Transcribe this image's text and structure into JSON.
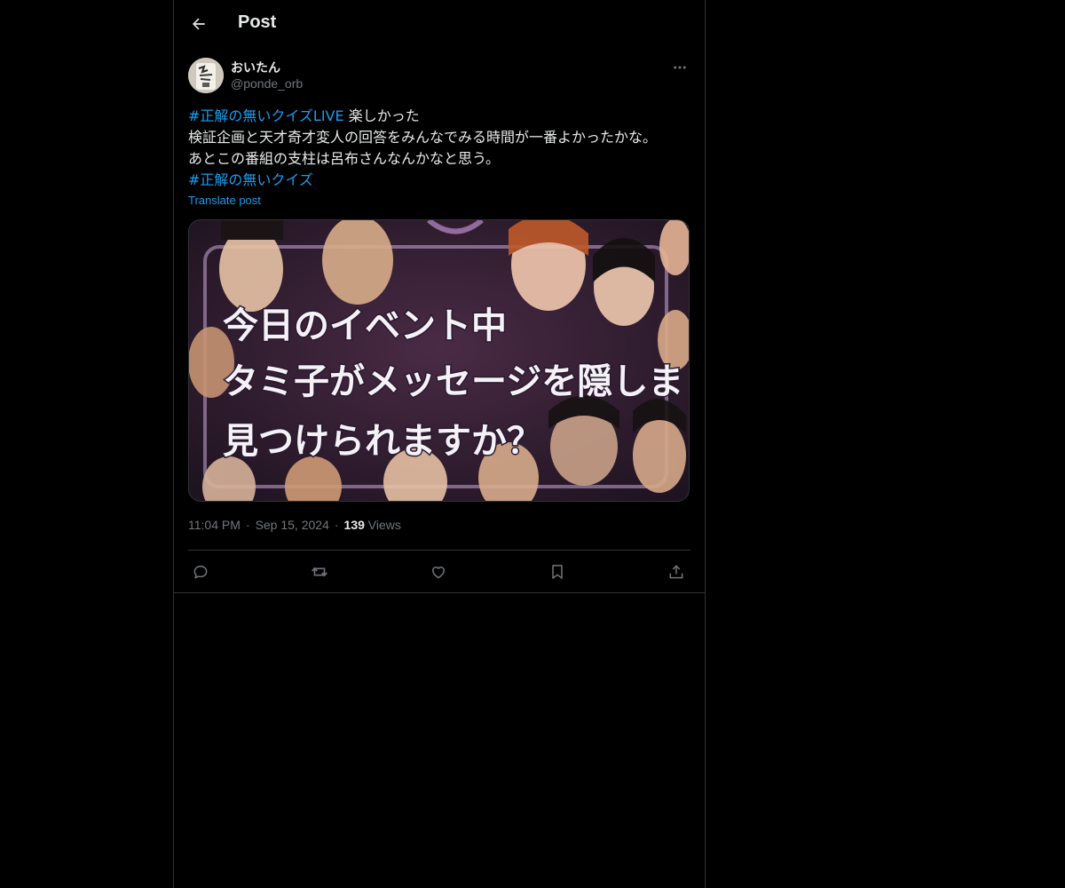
{
  "header": {
    "title": "Post"
  },
  "author": {
    "display_name": "おいたん",
    "handle": "@ponde_orb"
  },
  "tweet": {
    "hashtag_1": "#正解の無いクイズLIVE",
    "line_1_rest": " 楽しかった",
    "line_2": "検証企画と天才奇才変人の回答をみんなでみる時間が一番よかったかな。",
    "line_3": "あとこの番組の支柱は呂布さんなんかなと思う。",
    "hashtag_2": "#正解の無いクイズ",
    "translate_label": "Translate post"
  },
  "media": {
    "caption_line_1": "今日のイベント中",
    "caption_line_2": "タミ子がメッセージを隠しました。",
    "caption_line_3": "見つけられますか？"
  },
  "meta": {
    "time": "11:04 PM",
    "date": "Sep 15, 2024",
    "views_count": "139",
    "views_label": "Views",
    "separator": "·"
  },
  "actions": {
    "icons": [
      "reply-icon",
      "repost-icon",
      "like-icon",
      "bookmark-icon",
      "share-icon"
    ]
  },
  "colors": {
    "background": "#000000",
    "text": "#e7e9ea",
    "secondary": "#71767b",
    "accent": "#1d9bf0",
    "border": "#2f3336"
  }
}
